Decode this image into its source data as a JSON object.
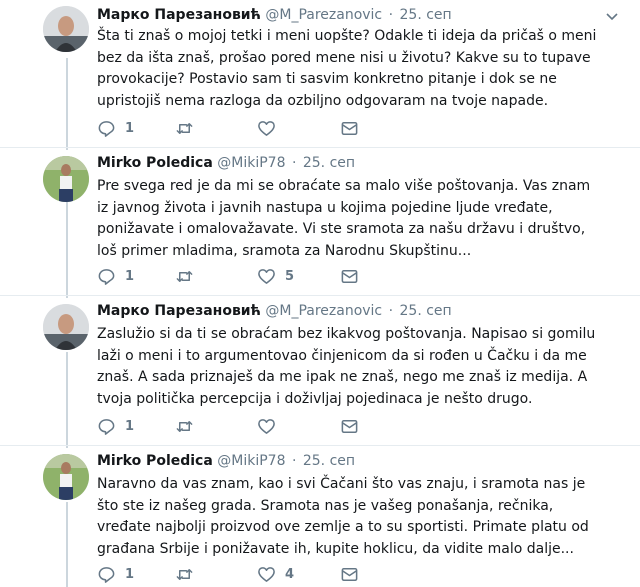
{
  "tweets": [
    {
      "name": "Марко Парезановић",
      "handle": "@M_Parezanovic",
      "time": "25. сеп",
      "text": "Šta ti znaš o mojoj tetki i meni uopšte? Odakle ti ideja da pričaš o meni bez da išta znaš, prošao pored mene nisi u životu? Kakve su to tupave provokacije? Postavio sam ti sasvim konkretno pitanje i dok se ne upristojiš nema razloga da ozbiljno odgovaram na tvoje napade.",
      "reply_count": "1",
      "retweet_count": "",
      "like_count": ""
    },
    {
      "name": "Mirko Poledica",
      "handle": "@MikiP78",
      "time": "25. сеп",
      "text": "Pre svega red je da mi se obraćate sa malo više poštovanja. Vas znam iz javnog života i javnih nastupa u kojima pojedine ljude vređate, ponižavate i omalovažavate. Vi ste sramota za našu državu i društvo, loš primer mladima, sramota za Narodnu Skupštinu...",
      "reply_count": "1",
      "retweet_count": "",
      "like_count": "5"
    },
    {
      "name": "Марко Парезановић",
      "handle": "@M_Parezanovic",
      "time": "25. сеп",
      "text": "Zaslužio si da ti se obraćam bez ikakvog poštovanja. Napisao si gomilu laži o meni i to argumentovao činjenicom da si rođen u Čačku i da me znaš. A sada priznaješ da me ipak ne znaš, nego me znaš iz medija. A tvoja politička percepcija i doživljaj pojedinaca je nešto drugo.",
      "reply_count": "1",
      "retweet_count": "",
      "like_count": ""
    },
    {
      "name": "Mirko Poledica",
      "handle": "@MikiP78",
      "time": "25. сеп",
      "text": "Naravno da vas znam, kao i svi Čačani što vas znaju, i sramota nas je što ste iz našeg grada. Sramota nas je vašeg ponašanja, rečnika, vređate najbolji proizvod ove zemlje a to su sportisti. Primate platu od građana Srbije i ponižavate ih, kupite hoklicu, da vidite malo dalje...",
      "reply_count": "1",
      "retweet_count": "",
      "like_count": "4"
    }
  ],
  "colors": {
    "text": "#14171a",
    "secondary": "#657786",
    "thread_line": "#ccd6dd",
    "divider": "#e6ecf0"
  },
  "icons": [
    "reply-icon",
    "retweet-icon",
    "like-icon",
    "direct-message-icon",
    "caret-down-icon"
  ]
}
